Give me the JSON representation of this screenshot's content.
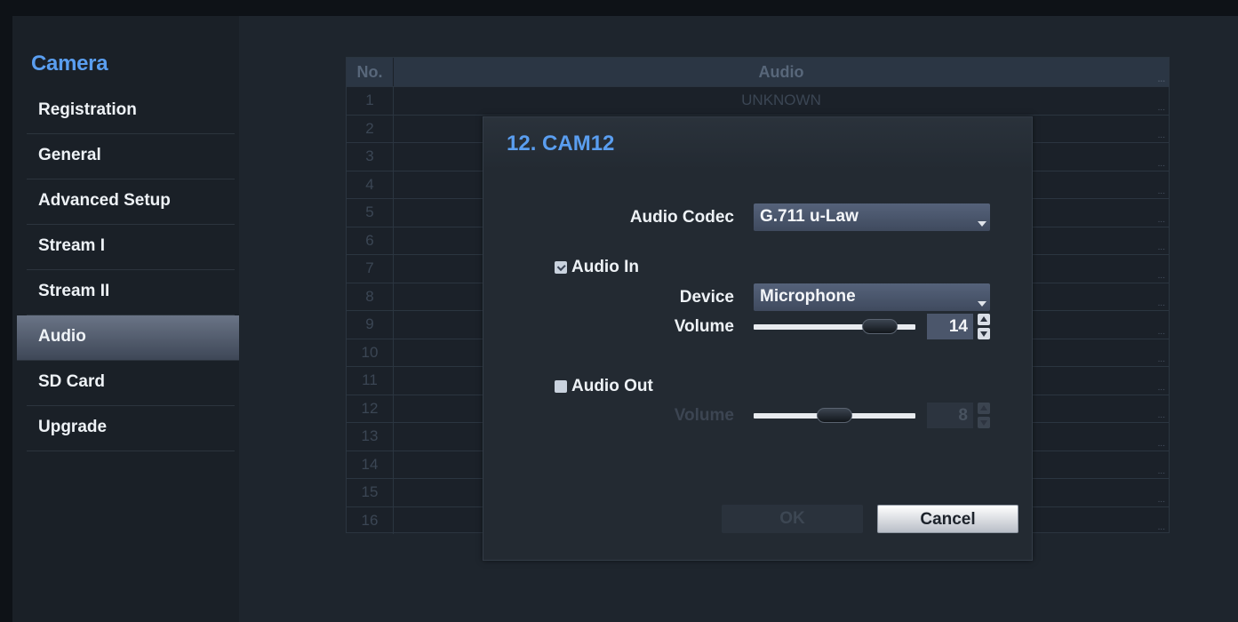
{
  "sidebar": {
    "title": "Camera",
    "items": [
      {
        "label": "Registration",
        "active": false
      },
      {
        "label": "General",
        "active": false
      },
      {
        "label": "Advanced Setup",
        "active": false
      },
      {
        "label": "Stream I",
        "active": false
      },
      {
        "label": "Stream II",
        "active": false
      },
      {
        "label": "Audio",
        "active": true
      },
      {
        "label": "SD Card",
        "active": false
      },
      {
        "label": "Upgrade",
        "active": false
      }
    ]
  },
  "table": {
    "columns": [
      "No.",
      "Audio"
    ],
    "more": "...",
    "rows": [
      {
        "no": "1",
        "audio": "UNKNOWN"
      },
      {
        "no": "2",
        "audio": ""
      },
      {
        "no": "3",
        "audio": ""
      },
      {
        "no": "4",
        "audio": ""
      },
      {
        "no": "5",
        "audio": ""
      },
      {
        "no": "6",
        "audio": ""
      },
      {
        "no": "7",
        "audio": ""
      },
      {
        "no": "8",
        "audio": ""
      },
      {
        "no": "9",
        "audio": ""
      },
      {
        "no": "10",
        "audio": ""
      },
      {
        "no": "11",
        "audio": ""
      },
      {
        "no": "12",
        "audio": ""
      },
      {
        "no": "13",
        "audio": ""
      },
      {
        "no": "14",
        "audio": ""
      },
      {
        "no": "15",
        "audio": ""
      },
      {
        "no": "16",
        "audio": ""
      }
    ]
  },
  "dialog": {
    "title": "12. CAM12",
    "codec_label": "Audio Codec",
    "codec_value": "G.711 u-Law",
    "audio_in": {
      "label": "Audio In",
      "checked": true,
      "device_label": "Device",
      "device_value": "Microphone",
      "volume_label": "Volume",
      "volume_value": "14",
      "volume_level": 0.8
    },
    "audio_out": {
      "label": "Audio Out",
      "checked": false,
      "volume_label": "Volume",
      "volume_value": "8",
      "volume_level": 0.5
    },
    "ok_label": "OK",
    "cancel_label": "Cancel"
  },
  "colors": {
    "accent": "#5a9ef0",
    "background": "#1e252d"
  }
}
